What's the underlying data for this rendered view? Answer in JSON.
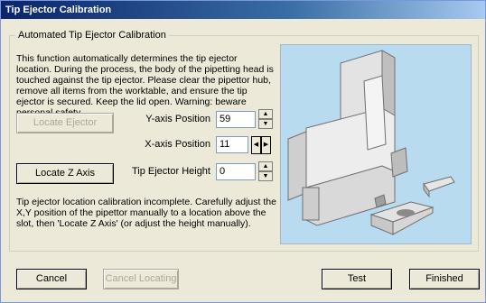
{
  "window": {
    "title": "Tip Ejector Calibration"
  },
  "group": {
    "title": "Automated Tip Ejector Calibration",
    "description": "This function automatically determines the tip ejector location. During the process, the body of the pipetting head is touched against the tip ejector. Please clear the pipettor hub, remove all items from the worktable, and ensure the tip ejector is secured. Keep the lid open. Warning: beware personal safety.",
    "status": "Tip ejector location calibration incomplete. Carefully adjust the X,Y position of the pipettor manually to a location above the slot, then 'Locate Z Axis' (or adjust the height manually)."
  },
  "buttons": {
    "locate_ejector": "Locate Ejector",
    "locate_z": "Locate Z Axis",
    "cancel": "Cancel",
    "cancel_locating": "Cancel Locating",
    "test": "Test",
    "finished": "Finished"
  },
  "fields": {
    "y_axis": {
      "label": "Y-axis Position",
      "value": "59"
    },
    "x_axis": {
      "label": "X-axis Position",
      "value": "11"
    },
    "height": {
      "label": "Tip Ejector Height",
      "value": "0"
    }
  },
  "colors": {
    "title_start": "#0A246A",
    "image_bg": "#B9DBEF"
  }
}
